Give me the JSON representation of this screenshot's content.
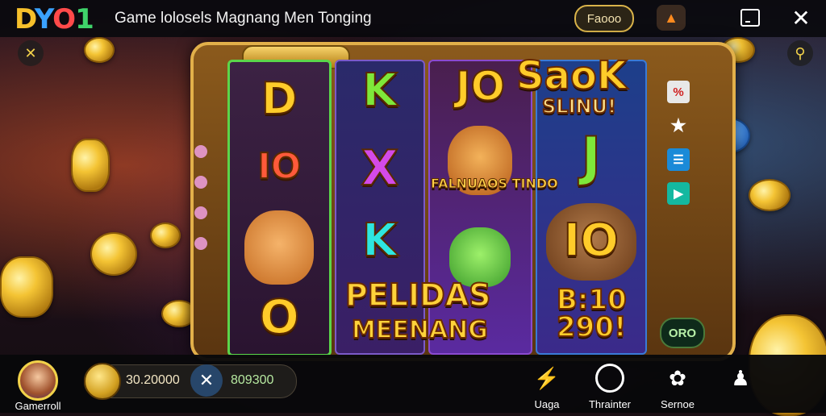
{
  "header": {
    "logo_letters": [
      "D",
      "Y",
      "O",
      "1"
    ],
    "title": "Game lolosels Magnang Men Tonging",
    "balance_pill": "Faooo",
    "fire_icon": "flame-icon",
    "screen_icon": "screen-icon",
    "close_icon": "close-icon"
  },
  "side_buttons": {
    "back_icon": "x-icon",
    "help_icon": "search-icon"
  },
  "reels": {
    "reel1": {
      "top": "D",
      "mid": "IO",
      "bottom": "O"
    },
    "reel2": {
      "top": "K",
      "mid": "X",
      "bottom": "K"
    },
    "reel3": {
      "top": "JO",
      "banner": "FALNUAOS TINDO"
    },
    "reel4": {
      "top": "SaoK",
      "sub": "SLINU!",
      "mid": "J",
      "low": "IO"
    }
  },
  "banners": {
    "main_line1": "PELIDAS",
    "main_line2": "MEENANG",
    "bonus_line1": "B:10",
    "bonus_line2": "290!"
  },
  "oro_button": "ORO",
  "player": {
    "name": "Gamerroll"
  },
  "wallet": {
    "left_value": "30.20000",
    "right_value": "809300"
  },
  "bottom_nav": [
    {
      "label": "Uaga",
      "icon": "lightning-icon"
    },
    {
      "label": "Thrainter",
      "icon": "timer-icon"
    },
    {
      "label": "Sernoe",
      "icon": "settings-icon"
    },
    {
      "label": "",
      "icon": "profile-icon"
    }
  ],
  "colors": {
    "accent_gold": "#f2d24a",
    "reel_border_green": "#5bd64a",
    "nav_active": "#ff8a1e"
  }
}
